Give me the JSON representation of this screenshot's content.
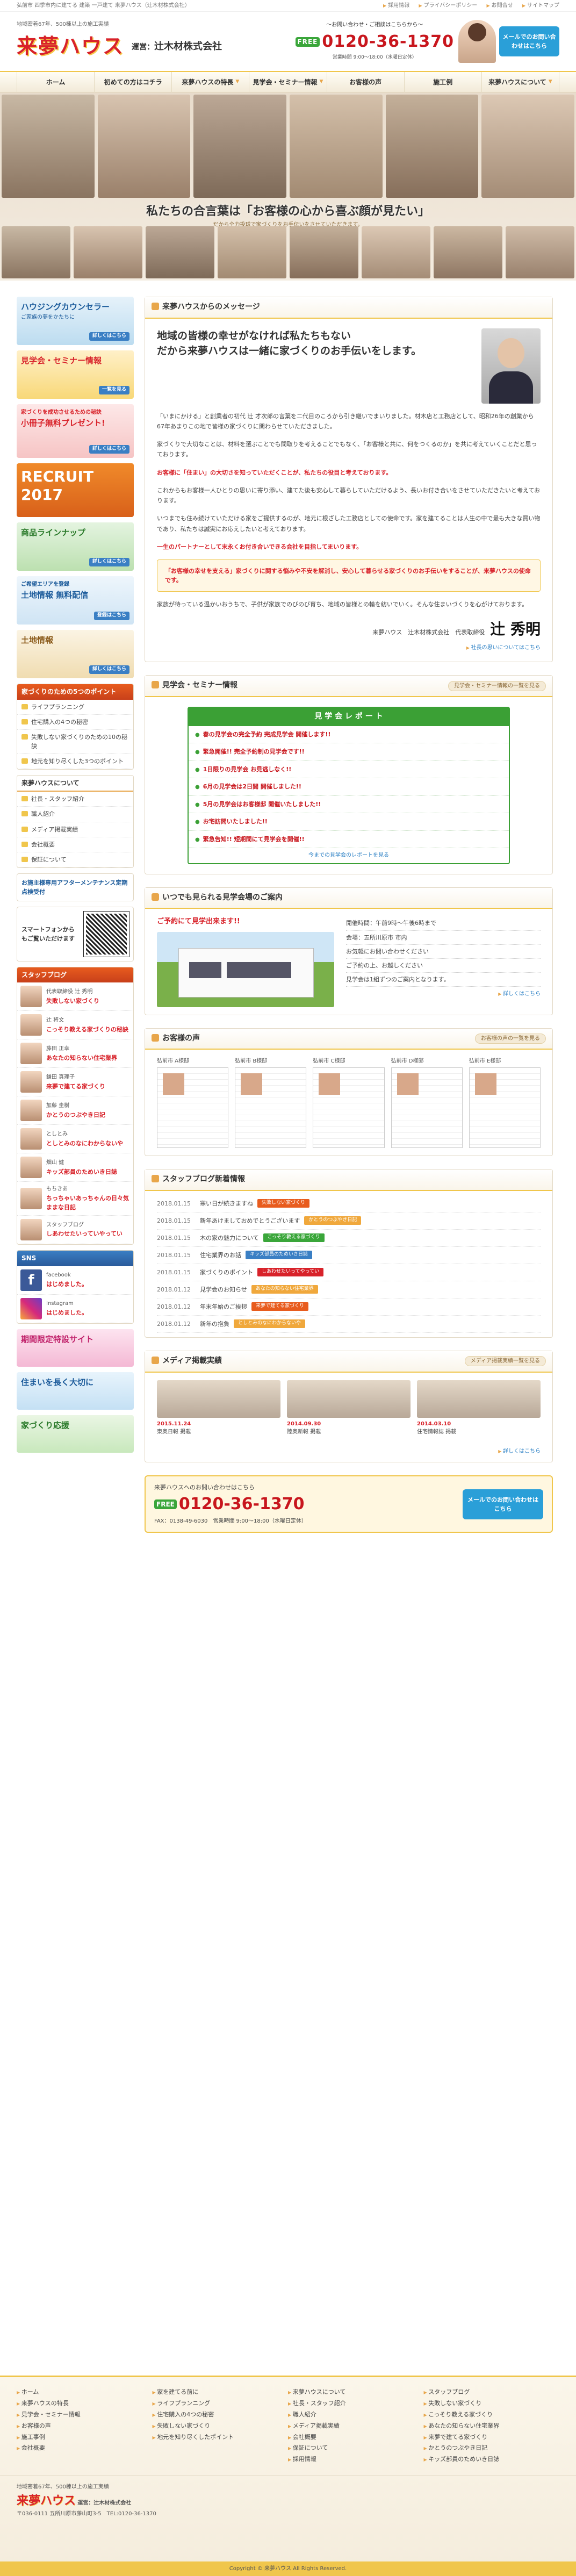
{
  "topbar": {
    "tag": "弘前市 四季市内に建てる 建築 一戸建て 来夢ハウス（辻木材株式会社）",
    "links": [
      "採用情報",
      "プライバシーポリシー",
      "お問合せ",
      "サイトマップ"
    ]
  },
  "header": {
    "tagline": "地域密着67年、500棟以上の施工実績",
    "brand": "来夢ハウス",
    "operator": "運営：",
    "operator_name": "辻木材株式会社",
    "contact_l1": "〜お問い合わせ・ご相談はこちらから〜",
    "tel": "0120-36-1370",
    "free_label": "FREE",
    "contact_l3": "営業時間 9:00〜18:00（水曜日定休）",
    "mail_btn": "メールでのお問い合わせはこちら"
  },
  "nav": [
    "ホーム",
    "初めての方はコチラ",
    "来夢ハウスの特長",
    "見学会・セミナー情報",
    "お客様の声",
    "施工例",
    "来夢ハウスについて"
  ],
  "hero": {
    "headline": "私たちの合言葉は「お客様の心から喜ぶ顔が見たい」",
    "sub": "だから全力投球で家づくりをお手伝いをさせていただきます。"
  },
  "side": {
    "banners": [
      {
        "title": "ハウジングカウンセラー",
        "sub": "ご家族の夢をかたちに",
        "btn": "詳しくはこちら"
      },
      {
        "title": "見学会・セミナー情報",
        "sub": "",
        "btn": "一覧を見る"
      },
      {
        "title": "小冊子無料プレゼント!",
        "sub": "家づくりを成功させるための秘訣",
        "btn": "詳しくはこちら"
      },
      {
        "title": "RECRUIT 2017",
        "sub": "",
        "btn": ""
      },
      {
        "title": "商品ラインナップ",
        "sub": "",
        "btn": "詳しくはこちら"
      },
      {
        "title": "土地情報 無料配信",
        "sub": "ご希望エリアを登録",
        "btn": "登録はこちら"
      },
      {
        "title": "土地情報",
        "sub": "",
        "btn": "詳しくはこちら"
      }
    ],
    "point_head": "家づくりのための5つのポイント",
    "points": [
      "ライフプランニング",
      "住宅購入の4つの秘密",
      "失敗しない家づくりのための10の秘訣",
      "地元を知り尽くした3つのポイント"
    ],
    "about_head": "来夢ハウスについて",
    "about": [
      "社長・スタッフ紹介",
      "職人紹介",
      "メディア掲載実績",
      "会社概要",
      "保証について"
    ],
    "after_title": "お施主様専用アフターメンテナンス定期点検受付",
    "sp_title": "スマートフォンからもご覧いただけます",
    "blog_head": "スタッフブログ",
    "blogs": [
      {
        "name": "代表取締役 辻 秀明",
        "title": "失敗しない家づくり"
      },
      {
        "name": "辻 将文",
        "title": "こっそり教える家づくりの秘訣"
      },
      {
        "name": "藤田 正幸",
        "title": "あなたの知らない住宅業界"
      },
      {
        "name": "鎌田 真理子",
        "title": "来夢で建てる家づくり"
      },
      {
        "name": "加藤 圭樹",
        "title": "かとうのつぶやき日記"
      },
      {
        "name": "としとみ",
        "title": "としとみのなにわからないや"
      },
      {
        "name": "畑山 健",
        "title": "キッズ部員のためいき日誌"
      },
      {
        "name": "もちきあ",
        "title": "ちっちゃいあっちゃんの日々気ままな日記"
      },
      {
        "name": "スタッフブログ",
        "title": "しあわせたいっていやってい"
      }
    ],
    "sns_head": "SNS",
    "sns": [
      {
        "name": "facebook",
        "title": "はじめました。"
      },
      {
        "name": "Instagram",
        "title": "はじめました。"
      }
    ],
    "extra": [
      "期間限定特設サイト",
      "住まいを長く大切に",
      "家づくり応援"
    ]
  },
  "message": {
    "head": "来夢ハウスからのメッセージ",
    "title1": "地域の皆様の幸せがなければ私たちもない",
    "title2": "だから来夢ハウスは一緒に家づくりのお手伝いをします。",
    "p1": "「いまにかける」と創業者の初代 辻 才次郎の言葉を二代目のころから引き継いでまいりました。材木店と工務店として、昭和26年の創業から67年あまりこの地で皆様の家づくりに関わらせていただきました。",
    "p2": "家づくりで大切なことは、材料を選ぶことでも間取りを考えることでもなく、「お客様と共に、何をつくるのか」を共に考えていくことだと思っております。",
    "red1": "お客様に「住まい」の大切さを知っていただくことが、私たちの役目と考えております。",
    "p3": "これからもお客様一人ひとりの思いに寄り添い、建てた後も安心して暮らしていただけるよう、長いお付き合いをさせていただきたいと考えております。",
    "p4": "いつまでも住み続けていただける家をご提供するのが、地元に根ざした工務店としての使命です。家を建てることは人生の中で最も大きな買い物であり、私たちは誠実にお応えしたいと考えております。",
    "red2": "一生のパートナーとして末永くお付き合いできる会社を目指してまいります。",
    "callout": "「お客様の幸せを支える」家づくりに関する悩みや不安を解消し、安心して暮らせる家づくりのお手伝いをすることが、来夢ハウスの使命です。",
    "p5": "家族が待っている温かいおうちで、子供が家族でのびのび育ち、地域の皆様との輪を紡いでいく。そんな住まいづくりを心がけております。",
    "sign_prefix": "来夢ハウス　辻木材株式会社　代表取締役",
    "sign_name": "辻 秀明",
    "link": "社長の思いについてはこちら"
  },
  "report": {
    "head": "見学会・セミナー情報",
    "more": "見学会・セミナー情報の一覧を見る",
    "title": "見 学 会 レ ポ ー ト",
    "items": [
      "春の見学会の完全予約 完成見学会 開催します!!",
      "緊急開催!! 完全予約制の見学会です!!",
      "1日限りの見学会 お見逃しなく!!",
      "6月の見学会は2日間 開催しました!!",
      "5月の見学会はお客様邸 開催いたしました!!",
      "お宅訪問いたしました!!",
      "緊急告知!! 短期間にて見学会を開催!!"
    ],
    "footer": "今までの見学会のレポートを見る"
  },
  "model": {
    "head": "いつでも見られる見学会場のご案内",
    "title": "ご予約にて見学出来ます!!",
    "rows": [
      "開催時間：午前9時〜午後6時まで",
      "会場：五所川原市 市内",
      "お気軽にお問い合わせください",
      "ご予約の上、お越しください",
      "見学会は1組ずつのご案内となります。"
    ],
    "link": "詳しくはこちら"
  },
  "voices": {
    "head": "お客様の声",
    "more": "お客様の声の一覧を見る",
    "items": [
      "弘前市 A様邸",
      "弘前市 B様邸",
      "弘前市 C様邸",
      "弘前市 D様邸",
      "弘前市 E様邸"
    ]
  },
  "bloglist": {
    "head": "スタッフブログ新着情報",
    "items": [
      {
        "date": "2018.01.15",
        "title": "寒い日が続きますね",
        "tag": "失敗しない家づくり",
        "color": "#e85c1e"
      },
      {
        "date": "2018.01.15",
        "title": "新年あけましておめでとうございます",
        "tag": "かとうのつぶやき日記",
        "color": "#f0a83c"
      },
      {
        "date": "2018.01.15",
        "title": "木の家の魅力について",
        "tag": "こっそり教える家づくり",
        "color": "#3aa63a"
      },
      {
        "date": "2018.01.15",
        "title": "住宅業界のお話",
        "tag": "キッズ部員のためいき日誌",
        "color": "#3a7fc4"
      },
      {
        "date": "2018.01.15",
        "title": "家づくりのポイント",
        "tag": "しあわせたいってやってい",
        "color": "#d8222a"
      },
      {
        "date": "2018.01.12",
        "title": "見学会のお知らせ",
        "tag": "あなたの知らない住宅業界",
        "color": "#f0a83c"
      },
      {
        "date": "2018.01.12",
        "title": "年末年始のご挨拶",
        "tag": "来夢で建てる家づくり",
        "color": "#e85c1e"
      },
      {
        "date": "2018.01.12",
        "title": "新年の抱負",
        "tag": "としとみのなにわからないや",
        "color": "#f0a83c"
      }
    ]
  },
  "media": {
    "head": "メディア掲載実績",
    "more": "メディア掲載実績一覧を見る",
    "items": [
      {
        "date": "2015.11.24",
        "title": "東奥日報 掲載"
      },
      {
        "date": "2014.09.30",
        "title": "陸奥新報 掲載"
      },
      {
        "date": "2014.03.10",
        "title": "住宅情報誌 掲載"
      }
    ],
    "link": "詳しくはこちら"
  },
  "contact2": {
    "tel": "0120-36-1370",
    "free_label": "FREE",
    "l1": "来夢ハウスへのお問い合わせはこちら",
    "l2": "FAX：0138-49-6030",
    "hours": "営業時間 9:00〜18:00（水曜日定休）",
    "btn": "メールでのお問い合わせはこちら"
  },
  "footer": {
    "cols": [
      [
        "ホーム",
        "来夢ハウスの特長",
        "見学会・セミナー情報",
        "お客様の声",
        "施工事例",
        "会社概要"
      ],
      [
        "家を建てる前に",
        "ライフプランニング",
        "住宅購入の4つの秘密",
        "失敗しない家づくり",
        "地元を知り尽くしたポイント"
      ],
      [
        "来夢ハウスについて",
        "社長・スタッフ紹介",
        "職人紹介",
        "メディア掲載実績",
        "会社概要",
        "保証について",
        "採用情報"
      ],
      [
        "スタッフブログ",
        "失敗しない家づくり",
        "こっそり教える家づくり",
        "あなたの知らない住宅業界",
        "来夢で建てる家づくり",
        "かとうのつぶやき日記",
        "キッズ部員のためいき日誌"
      ]
    ],
    "tagline": "地域密着67年、500棟以上の施工実績",
    "brand": "来夢ハウス",
    "operator": "運営：辻木材株式会社",
    "address": "〒036-0111 五所川原市藤山町3-5　TEL:0120-36-1370",
    "copy": "Copyright © 来夢ハウス All Rights Reserved."
  },
  "colors": {
    "accent": "#d8222a",
    "gold": "#f0c64c",
    "green": "#3ba035",
    "blue": "#2a9fd8"
  }
}
